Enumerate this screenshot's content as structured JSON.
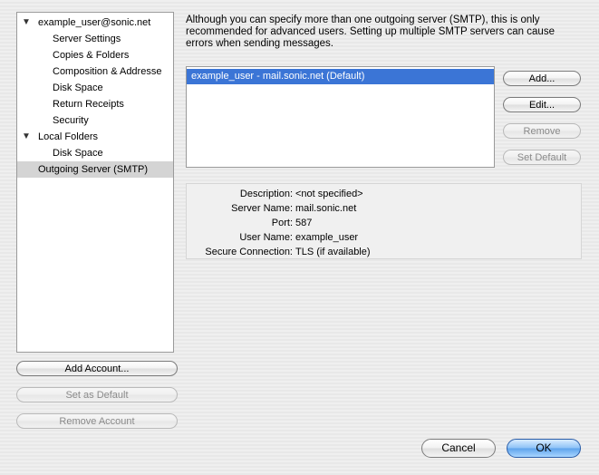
{
  "tree": {
    "account": {
      "label": "example_user@sonic.net",
      "children": [
        "Server Settings",
        "Copies & Folders",
        "Composition & Addresse",
        "Disk Space",
        "Return Receipts",
        "Security"
      ]
    },
    "local": {
      "label": "Local Folders",
      "children": [
        "Disk Space"
      ]
    },
    "outgoing": "Outgoing Server (SMTP)"
  },
  "left_buttons": {
    "add_account": "Add Account...",
    "set_default": "Set as Default",
    "remove_account": "Remove Account"
  },
  "smtp": {
    "intro": "Although you can specify more than one outgoing server (SMTP), this is only\nrecommended for advanced users. Setting up multiple SMTP servers can cause\nerrors when sending messages.",
    "servers": [
      "example_user - mail.sonic.net (Default)"
    ],
    "buttons": {
      "add": "Add...",
      "edit": "Edit...",
      "remove": "Remove",
      "set_default": "Set Default"
    },
    "details": [
      {
        "key": "Description:",
        "value": "<not specified>"
      },
      {
        "key": "Server Name:",
        "value": "mail.sonic.net"
      },
      {
        "key": "Port:",
        "value": "587"
      },
      {
        "key": "User Name:",
        "value": "example_user"
      },
      {
        "key": "Secure Connection:",
        "value": "TLS (if available)"
      }
    ]
  },
  "dialog": {
    "cancel": "Cancel",
    "ok": "OK"
  }
}
